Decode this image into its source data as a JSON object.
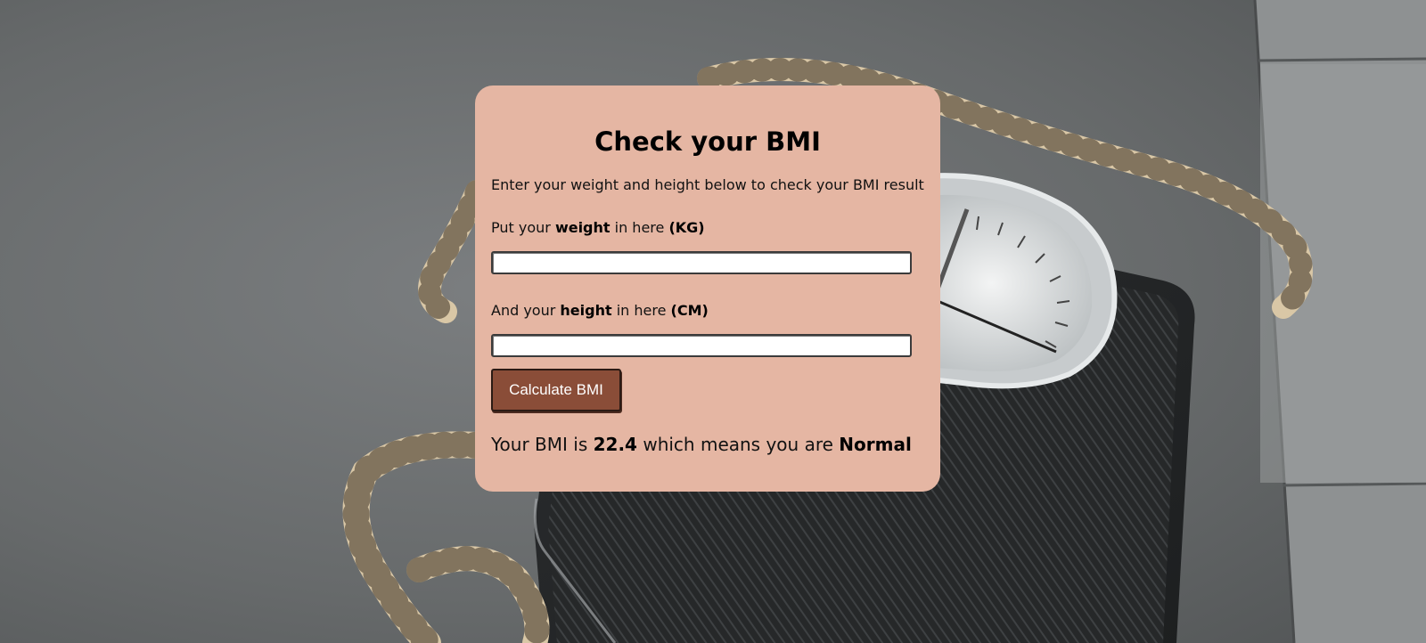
{
  "page": {
    "title": "Check your BMI",
    "subtitle": "Enter your weight and height below to check your BMI result"
  },
  "weight": {
    "prefix": "Put your ",
    "keyword": "weight",
    "middle": " in here ",
    "unit": "(KG)",
    "value": ""
  },
  "height": {
    "prefix": "And your ",
    "keyword": "height",
    "middle": " in here ",
    "unit": "(CM)",
    "value": ""
  },
  "button": {
    "label": "Calculate BMI"
  },
  "result": {
    "prefix": "Your BMI is ",
    "value": "22.4",
    "middle": " which means you are ",
    "category": "Normal"
  },
  "colors": {
    "card_background": "#e5b6a3",
    "button_background": "#8a4d38",
    "button_text": "#ffffff"
  },
  "background": {
    "icon": "bathroom-scale-with-measuring-tape-photo"
  }
}
